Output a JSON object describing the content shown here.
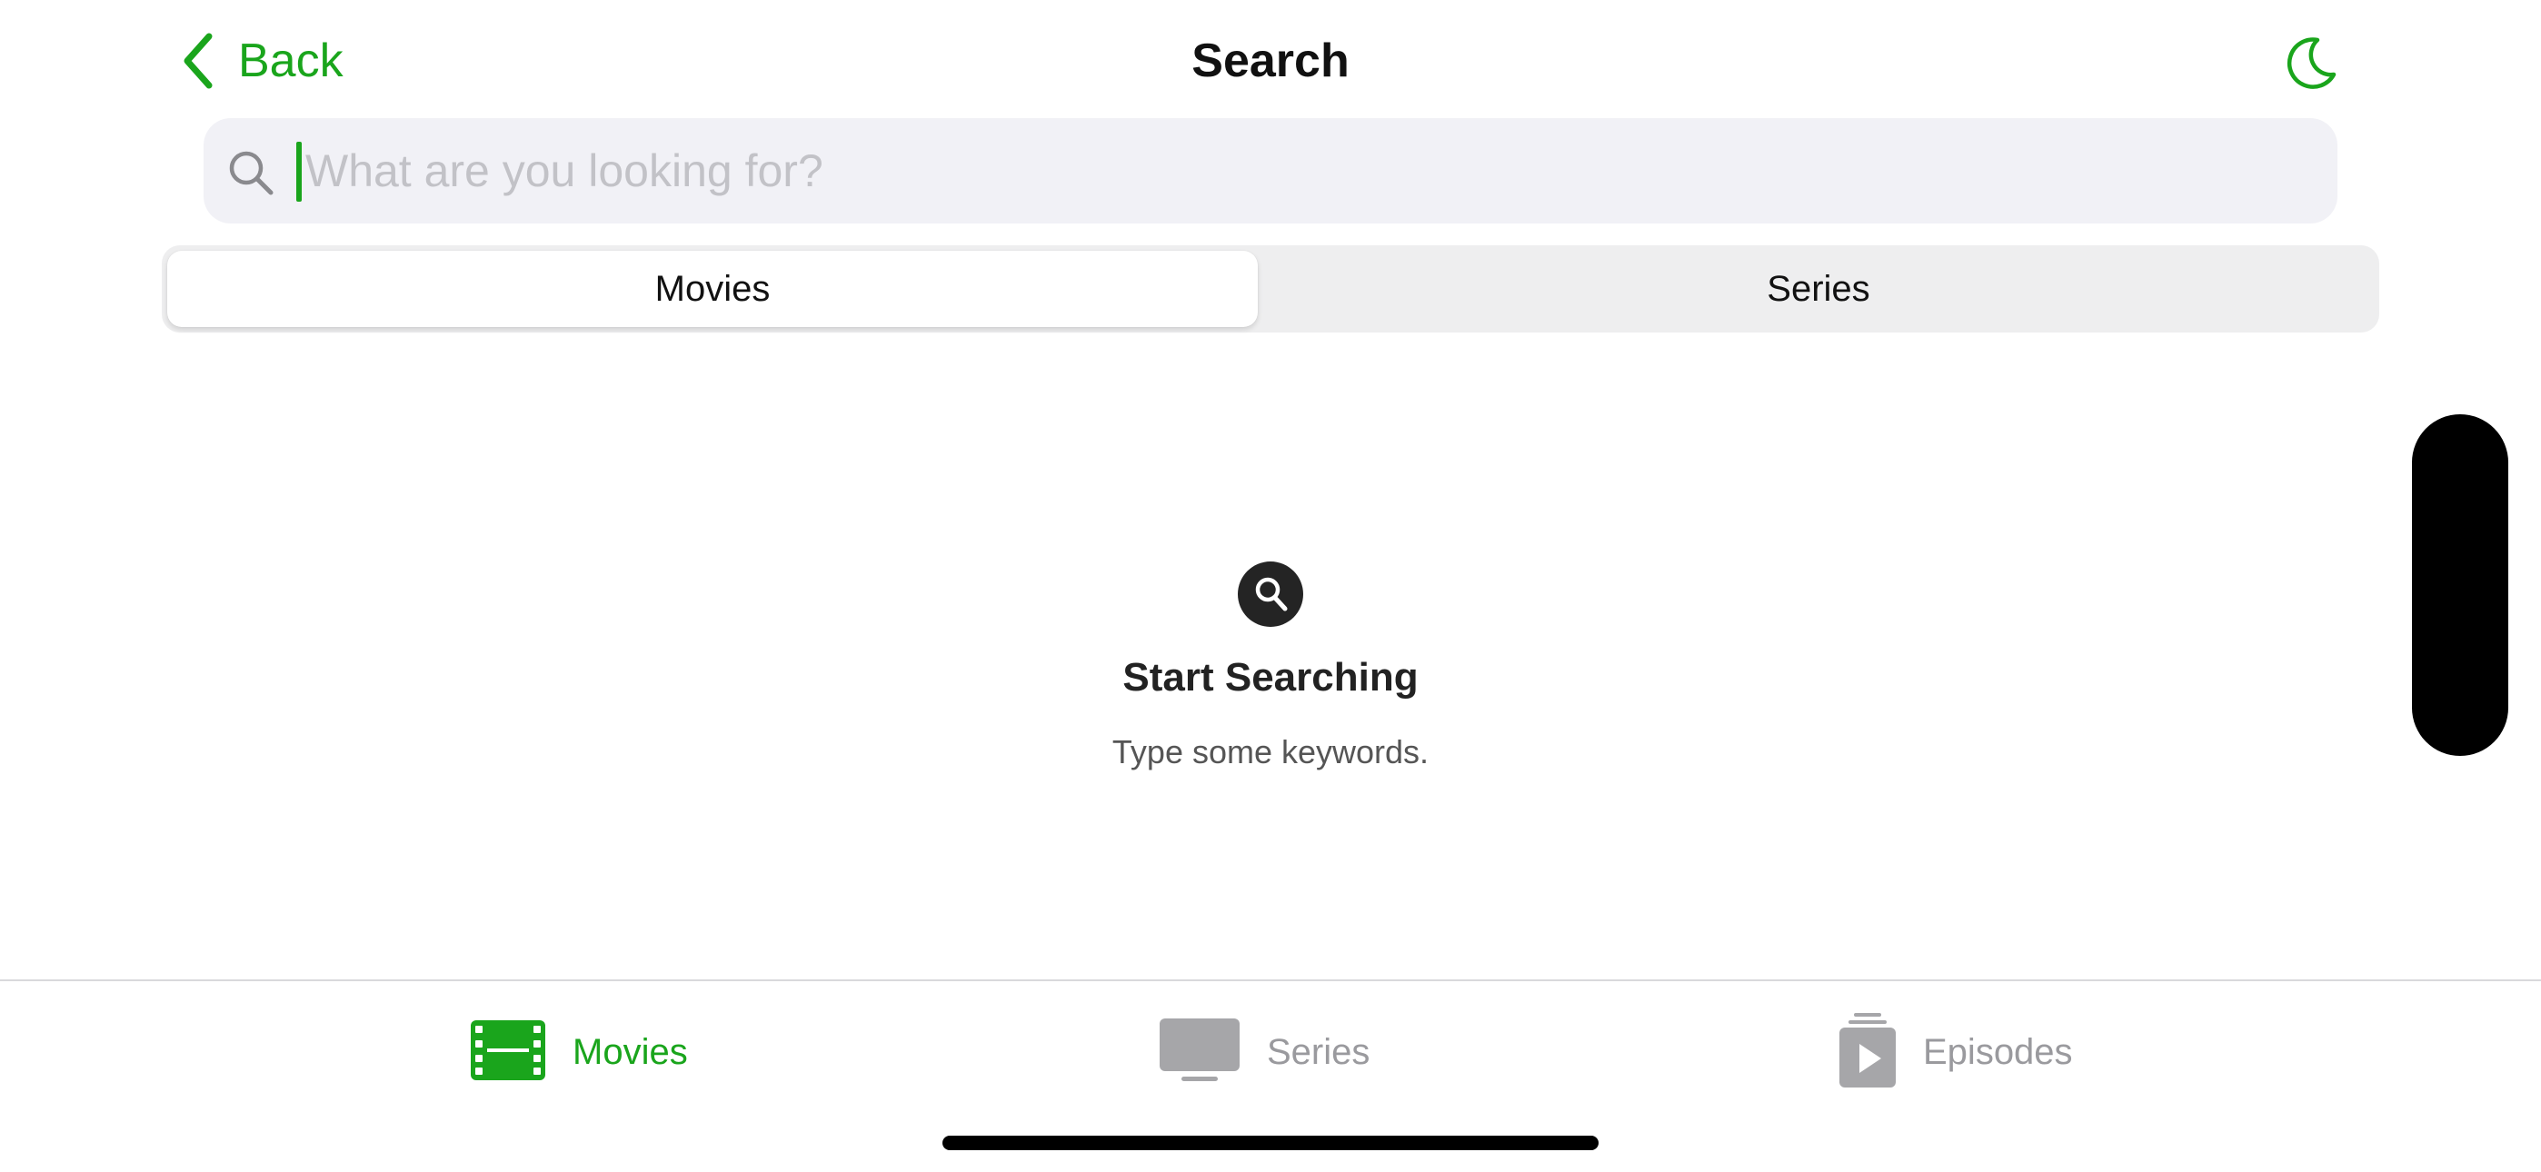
{
  "nav": {
    "back_label": "Back",
    "title": "Search",
    "theme_icon": "moon-icon"
  },
  "search": {
    "placeholder": "What are you looking for?",
    "value": "",
    "icon": "search-icon"
  },
  "segments": {
    "items": [
      {
        "label": "Movies",
        "selected": true
      },
      {
        "label": "Series",
        "selected": false
      }
    ]
  },
  "empty_state": {
    "icon": "search-icon",
    "title": "Start Searching",
    "subtitle": "Type some keywords."
  },
  "tabbar": {
    "items": [
      {
        "label": "Movies",
        "icon": "film-icon",
        "active": true
      },
      {
        "label": "Series",
        "icon": "tv-icon",
        "active": false
      },
      {
        "label": "Episodes",
        "icon": "episodes-stack-icon",
        "active": false
      }
    ]
  },
  "colors": {
    "accent": "#1aa51c",
    "inactive": "#9a9a9e",
    "field_bg": "#f1f1f6"
  }
}
